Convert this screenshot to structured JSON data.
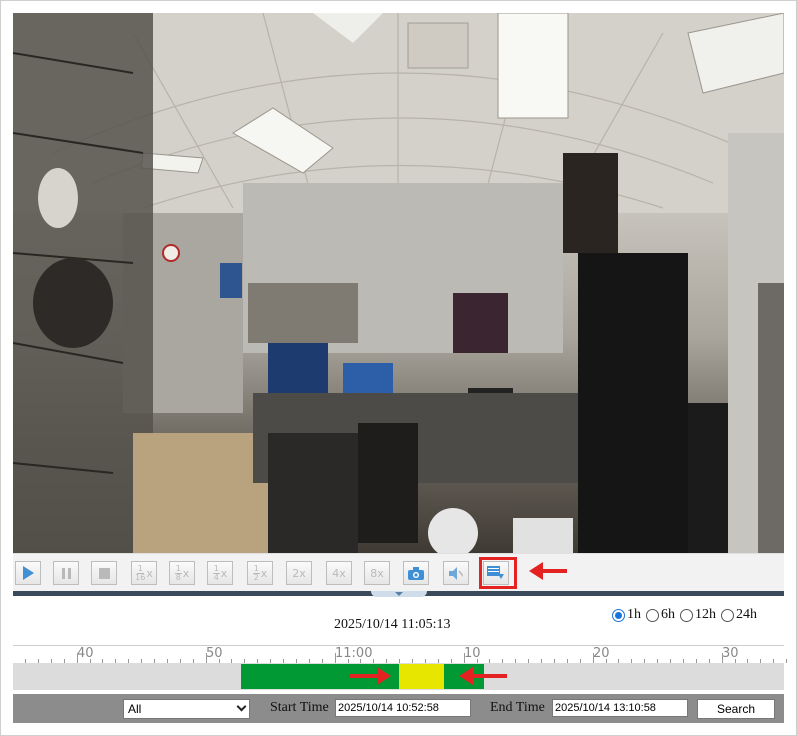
{
  "toolbar": {
    "buttons": [
      {
        "name": "play-button",
        "icon": "play-icon"
      },
      {
        "name": "pause-button",
        "icon": "pause-icon"
      },
      {
        "name": "stop-button",
        "icon": "stop-icon"
      },
      {
        "name": "speed-1-16-button",
        "num": "1",
        "den": "16",
        "suffix": "x"
      },
      {
        "name": "speed-1-8-button",
        "num": "1",
        "den": "8",
        "suffix": "x"
      },
      {
        "name": "speed-1-4-button",
        "num": "1",
        "den": "4",
        "suffix": "x"
      },
      {
        "name": "speed-1-2-button",
        "num": "1",
        "den": "2",
        "suffix": "x"
      },
      {
        "name": "speed-2x-button",
        "label": "2x"
      },
      {
        "name": "speed-4x-button",
        "label": "4x"
      },
      {
        "name": "speed-8x-button",
        "label": "8x"
      },
      {
        "name": "snapshot-button",
        "icon": "camera-icon"
      },
      {
        "name": "mute-button",
        "icon": "speaker-mute-icon"
      },
      {
        "name": "download-clip-button",
        "icon": "download-video-icon"
      }
    ]
  },
  "playback": {
    "current_time": "2025/10/14 11:05:13"
  },
  "ranges": {
    "options": [
      "1h",
      "6h",
      "12h",
      "24h"
    ],
    "selected": "1h"
  },
  "ruler": {
    "labels": [
      "40",
      "50",
      "11:00",
      "10",
      "20",
      "30"
    ]
  },
  "timeline": {
    "segments": [
      {
        "type": "recording",
        "color": "#009933"
      },
      {
        "type": "selected",
        "color": "#e6e600"
      },
      {
        "type": "recording",
        "color": "#009933"
      }
    ]
  },
  "search": {
    "filter_value": "All",
    "start_label": "Start Time",
    "start_value": "2025/10/14 10:52:58",
    "end_label": "End Time",
    "end_value": "2025/10/14 13:10:58",
    "button_label": "Search"
  }
}
